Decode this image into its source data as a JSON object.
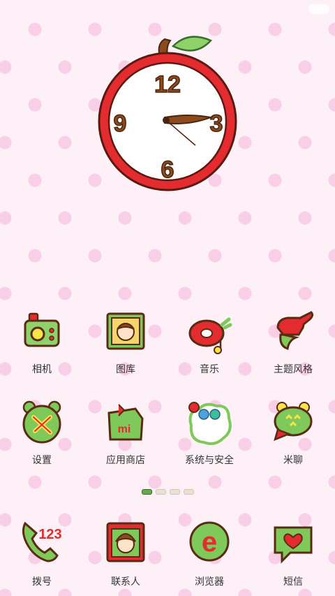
{
  "clock": {
    "numerals": {
      "twelve": "12",
      "three": "3",
      "six": "6",
      "nine": "9"
    }
  },
  "grid": {
    "row1": [
      {
        "label": "相机",
        "icon": "camera-icon"
      },
      {
        "label": "图库",
        "icon": "gallery-icon"
      },
      {
        "label": "音乐",
        "icon": "music-icon"
      },
      {
        "label": "主题风格",
        "icon": "theme-icon"
      }
    ],
    "row2": [
      {
        "label": "设置",
        "icon": "settings-icon"
      },
      {
        "label": "应用商店",
        "icon": "app-store-icon"
      },
      {
        "label": "系统与安全",
        "icon": "security-icon"
      },
      {
        "label": "米聊",
        "icon": "chat-icon"
      }
    ]
  },
  "pages": {
    "count": 4,
    "active_index": 0
  },
  "dock": [
    {
      "label": "拨号",
      "icon": "phone-icon",
      "digits": "123"
    },
    {
      "label": "联系人",
      "icon": "contacts-icon"
    },
    {
      "label": "浏览器",
      "icon": "browser-icon",
      "glyph": "e"
    },
    {
      "label": "短信",
      "icon": "sms-icon"
    }
  ],
  "app_store_glyph": "mi",
  "colors": {
    "apple_red": "#e32b30",
    "leaf_green": "#8fd16a",
    "outline": "#5a2b12",
    "page_indicator_active": "#6aa84f"
  }
}
